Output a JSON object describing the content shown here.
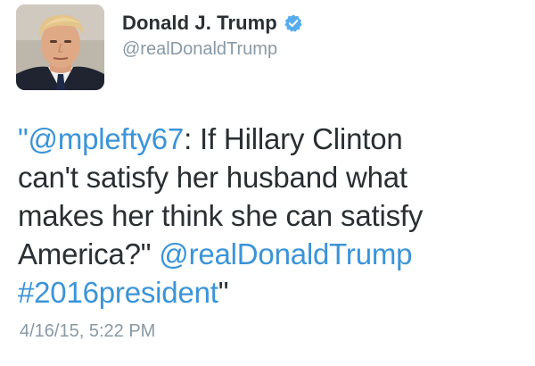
{
  "author": {
    "display_name": "Donald J. Trump",
    "handle": "@realDonaldTrump",
    "verified_icon": "verified-badge-icon",
    "avatar_icon": "profile-photo"
  },
  "tweet": {
    "line1_quote_open": "\"",
    "line1_mention": "@mplefty67",
    "line1_rest": ":  If Hillary Clinton",
    "line2": "can't satisfy her husband what",
    "line3": "makes her think she can satisfy",
    "line4_text": "America?\" ",
    "line4_mention": "@realDonaldTrump",
    "line5_hashtag": "#2016president",
    "line5_quote_close": "\"",
    "timestamp": "4/16/15, 5:22 PM"
  },
  "colors": {
    "text": "#292f33",
    "muted": "#8899a6",
    "link": "#3b94d9",
    "verified": "#55acee"
  }
}
